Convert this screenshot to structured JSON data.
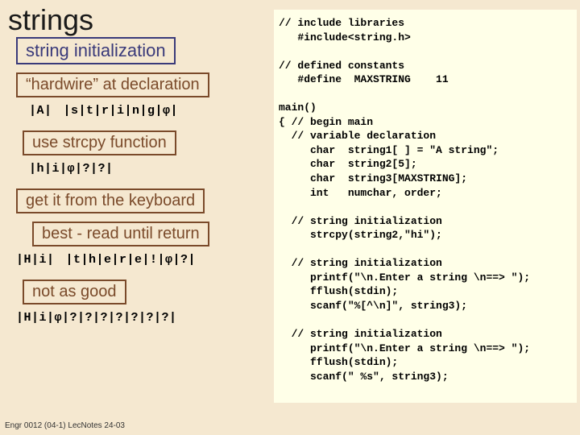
{
  "title": "strings",
  "left": {
    "string_init": "string initialization",
    "hardwire": "“hardwire” at declaration",
    "row_hardwire_a": "|A|",
    "row_hardwire_b": "|s|t|r|i|n|g|φ|",
    "use_strcpy": "use strcpy function",
    "row_strcpy": "|h|i|φ|?|?|",
    "get_keyboard": "get it from the keyboard",
    "best_read": "best - read until return",
    "row_best_a": "|H|i|",
    "row_best_b": "|t|h|e|r|e|!|φ|?|",
    "not_as_good": "not as good",
    "row_notgood": "|H|i|φ|?|?|?|?|?|?|?|"
  },
  "code": {
    "l01": "// include libraries",
    "l02": "   #include<string.h>",
    "l03": "",
    "l04": "// defined constants",
    "l05": "   #define  MAXSTRING    11",
    "l06": "",
    "l07": "main()",
    "l08": "{ // begin main",
    "l09": "  // variable declaration",
    "l10": "     char  string1[ ] = \"A string\";",
    "l11": "     char  string2[5];",
    "l12": "     char  string3[MAXSTRING];",
    "l13": "     int   numchar, order;",
    "l14": "",
    "l15": "  // string initialization",
    "l16": "     strcpy(string2,\"hi\");",
    "l17": "",
    "l18": "  // string initialization",
    "l19": "     printf(\"\\n.Enter a string \\n==> \");",
    "l20": "     fflush(stdin);",
    "l21": "     scanf(\"%[^\\n]\", string3);",
    "l22": "",
    "l23": "  // string initialization",
    "l24": "     printf(\"\\n.Enter a string \\n==> \");",
    "l25": "     fflush(stdin);",
    "l26": "     scanf(\" %s\", string3);"
  },
  "footer": "Engr 0012 (04-1) LecNotes 24-03"
}
